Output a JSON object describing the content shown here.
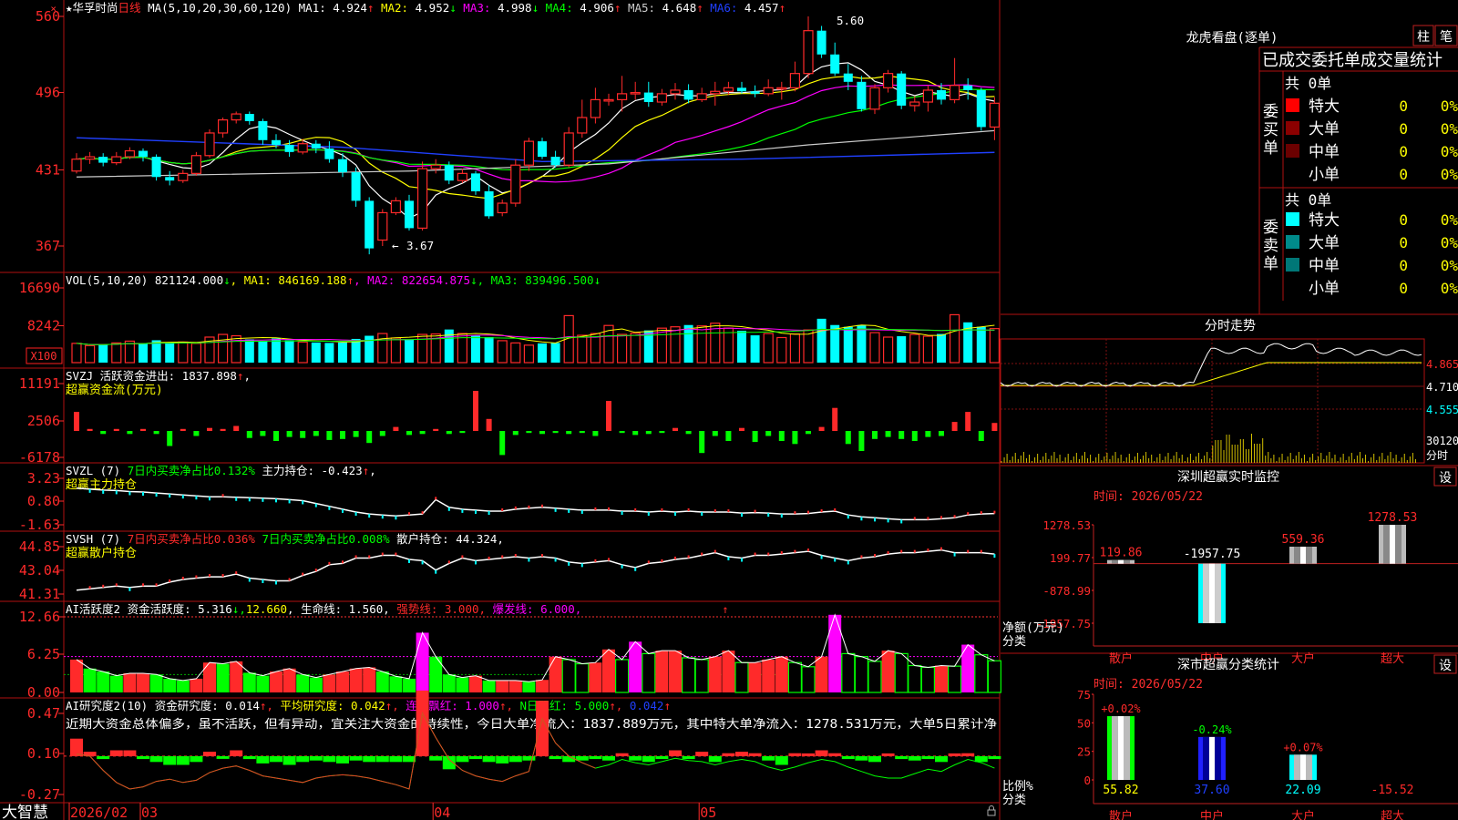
{
  "header": {
    "star": "★",
    "stock_name": "华孚时尚",
    "period": "日线",
    "ma_title": "MA(5,10,20,30,60,120)",
    "ma": [
      {
        "label": "MA1:",
        "value": "4.924",
        "arrow": "↑",
        "color": "#ffffff"
      },
      {
        "label": "MA2:",
        "value": "4.952",
        "arrow": "↓",
        "color": "#ffff00"
      },
      {
        "label": "MA3:",
        "value": "4.998",
        "arrow": "↓",
        "color": "#ff00ff"
      },
      {
        "label": "MA4:",
        "value": "4.906",
        "arrow": "↑",
        "color": "#00ff00"
      },
      {
        "label": "MA5:",
        "value": "4.648",
        "arrow": "↑",
        "color": "#cccccc"
      },
      {
        "label": "MA6:",
        "value": "4.457",
        "arrow": "↑",
        "color": "#2040ff"
      }
    ]
  },
  "kline": {
    "y_ticks": [
      "560",
      "496",
      "431",
      "367"
    ],
    "y_vals": [
      5.6,
      4.96,
      4.31,
      3.67
    ],
    "high_label": "5.60",
    "low_label": "3.67",
    "candles": [
      [
        4.3,
        4.4,
        4.28,
        4.45
      ],
      [
        4.4,
        4.42,
        4.36,
        4.46
      ],
      [
        4.42,
        4.37,
        4.34,
        4.45
      ],
      [
        4.37,
        4.42,
        4.35,
        4.46
      ],
      [
        4.42,
        4.47,
        4.4,
        4.5
      ],
      [
        4.47,
        4.42,
        4.38,
        4.49
      ],
      [
        4.42,
        4.25,
        4.22,
        4.44
      ],
      [
        4.25,
        4.22,
        4.18,
        4.3
      ],
      [
        4.22,
        4.28,
        4.2,
        4.31
      ],
      [
        4.28,
        4.43,
        4.26,
        4.46
      ],
      [
        4.43,
        4.62,
        4.41,
        4.65
      ],
      [
        4.62,
        4.73,
        4.58,
        4.75
      ],
      [
        4.73,
        4.78,
        4.7,
        4.8
      ],
      [
        4.78,
        4.72,
        4.69,
        4.8
      ],
      [
        4.72,
        4.56,
        4.52,
        4.74
      ],
      [
        4.56,
        4.52,
        4.49,
        4.61
      ],
      [
        4.52,
        4.46,
        4.42,
        4.56
      ],
      [
        4.46,
        4.53,
        4.44,
        4.57
      ],
      [
        4.53,
        4.49,
        4.45,
        4.56
      ],
      [
        4.49,
        4.4,
        4.37,
        4.55
      ],
      [
        4.4,
        4.29,
        4.25,
        4.45
      ],
      [
        4.29,
        4.05,
        4.0,
        4.33
      ],
      [
        4.05,
        3.65,
        3.6,
        4.08
      ],
      [
        3.72,
        3.95,
        3.67,
        3.98
      ],
      [
        3.95,
        4.05,
        3.93,
        4.08
      ],
      [
        4.05,
        3.82,
        3.8,
        4.1
      ],
      [
        3.82,
        4.32,
        3.8,
        4.38
      ],
      [
        4.32,
        4.35,
        4.28,
        4.4
      ],
      [
        4.35,
        4.22,
        4.19,
        4.38
      ],
      [
        4.22,
        4.28,
        4.2,
        4.32
      ],
      [
        4.28,
        4.13,
        4.1,
        4.3
      ],
      [
        4.13,
        3.92,
        3.9,
        4.18
      ],
      [
        3.95,
        4.03,
        3.92,
        4.06
      ],
      [
        4.03,
        4.35,
        4.0,
        4.4
      ],
      [
        4.35,
        4.55,
        4.3,
        4.58
      ],
      [
        4.55,
        4.42,
        4.4,
        4.58
      ],
      [
        4.42,
        4.35,
        4.33,
        4.47
      ],
      [
        4.35,
        4.62,
        4.33,
        4.67
      ],
      [
        4.62,
        4.75,
        4.58,
        4.9
      ],
      [
        4.75,
        4.9,
        4.7,
        5.0
      ],
      [
        4.9,
        4.9,
        4.85,
        4.95
      ],
      [
        4.9,
        4.95,
        4.8,
        5.1
      ],
      [
        4.95,
        4.96,
        4.9,
        5.05
      ],
      [
        4.96,
        4.88,
        4.84,
        5.05
      ],
      [
        4.88,
        4.95,
        4.85,
        4.99
      ],
      [
        4.95,
        4.98,
        4.9,
        5.04
      ],
      [
        4.98,
        4.9,
        4.87,
        5.03
      ],
      [
        4.9,
        4.95,
        4.88,
        5.0
      ],
      [
        4.95,
        4.97,
        4.85,
        5.05
      ],
      [
        4.97,
        5.0,
        4.94,
        5.05
      ],
      [
        5.0,
        4.97,
        4.95,
        5.05
      ],
      [
        4.97,
        4.95,
        4.92,
        5.02
      ],
      [
        4.95,
        5.0,
        4.93,
        5.07
      ],
      [
        5.0,
        5.0,
        4.9,
        5.05
      ],
      [
        5.0,
        5.12,
        4.97,
        5.22
      ],
      [
        5.12,
        5.48,
        5.08,
        5.6
      ],
      [
        5.48,
        5.28,
        5.25,
        5.52
      ],
      [
        5.28,
        5.12,
        5.1,
        5.38
      ],
      [
        5.12,
        5.05,
        4.98,
        5.2
      ],
      [
        5.05,
        4.82,
        4.8,
        5.1
      ],
      [
        4.82,
        5.0,
        4.78,
        5.03
      ],
      [
        5.0,
        5.12,
        4.96,
        5.15
      ],
      [
        5.12,
        4.85,
        4.82,
        5.14
      ],
      [
        4.85,
        4.88,
        4.8,
        4.93
      ],
      [
        4.88,
        4.98,
        4.8,
        5.02
      ],
      [
        4.98,
        4.9,
        4.86,
        5.04
      ],
      [
        4.9,
        5.02,
        4.87,
        5.25
      ],
      [
        5.02,
        4.98,
        4.9,
        5.08
      ],
      [
        4.98,
        4.67,
        4.64,
        5.0
      ],
      [
        4.67,
        4.87,
        4.56,
        4.92
      ]
    ]
  },
  "vol": {
    "title": "VOL(5,10,20)",
    "value": "821124.000",
    "value_arrow": "↓",
    "mas": [
      {
        "label": "MA1:",
        "value": "846169.188",
        "arrow": "↑",
        "color": "#ffff00"
      },
      {
        "label": "MA2:",
        "value": "822654.875",
        "arrow": "↓",
        "color": "#ff00ff"
      },
      {
        "label": "MA3:",
        "value": "839496.500",
        "arrow": "↓",
        "color": "#00ff00"
      }
    ],
    "y_ticks": [
      "16690",
      "8242"
    ],
    "unit": "X100",
    "values": [
      4.3,
      3.8,
      4.0,
      4.4,
      4.8,
      4.2,
      5.0,
      4.4,
      4.6,
      4.3,
      5.7,
      6.3,
      6.0,
      5.2,
      4.8,
      5.4,
      5.0,
      4.6,
      4.5,
      4.4,
      4.5,
      5.3,
      6.0,
      6.5,
      5.5,
      5.1,
      6.3,
      6.4,
      7.4,
      6.5,
      6.0,
      5.7,
      4.9,
      4.4,
      3.9,
      4.3,
      4.4,
      10.5,
      6.1,
      6.5,
      8.3,
      6.3,
      6.6,
      7.2,
      7.7,
      8.0,
      8.4,
      8.2,
      8.8,
      7.7,
      7.1,
      6.1,
      6.5,
      5.6,
      6.4,
      7.3,
      9.8,
      8.4,
      8.0,
      8.4,
      6.7,
      5.7,
      5.9,
      6.3,
      5.9,
      6.4,
      10.7,
      9.0,
      8.0,
      7.6
    ]
  },
  "svzj": {
    "title": "SVZJ",
    "label": "活跃资金进出:",
    "value": "1837.898",
    "arrow": "↑",
    "subtitle": "超赢资金流(万元)",
    "y_ticks": [
      "11191",
      "2506",
      "-6178"
    ],
    "values": [
      1.9,
      0.2,
      -0.3,
      0.2,
      -0.3,
      0.2,
      -0.3,
      -1.5,
      0.2,
      -0.5,
      0.3,
      0.2,
      0.5,
      -0.7,
      -0.5,
      -1.0,
      -0.6,
      -0.7,
      -0.5,
      -0.9,
      -0.8,
      -0.6,
      -1.2,
      -0.5,
      0.4,
      -0.4,
      -0.3,
      0.2,
      -0.3,
      -0.2,
      4.0,
      1.2,
      -2.4,
      -0.4,
      -0.2,
      -0.3,
      -0.2,
      -0.3,
      -0.2,
      -0.5,
      3.0,
      -0.2,
      -0.4,
      -0.3,
      -0.2,
      0.3,
      -0.3,
      -2.2,
      -0.5,
      -1.0,
      0.3,
      -1.1,
      -0.5,
      -1.0,
      -1.3,
      -0.3,
      0.4,
      2.3,
      -1.3,
      -2.0,
      -0.8,
      -0.6,
      -0.8,
      -1.0,
      -0.6,
      -0.5,
      0.9,
      1.9,
      -1.0,
      0.8
    ]
  },
  "svzl": {
    "title": "SVZL (7)",
    "p1": "7日内买卖净占比0.132%",
    "label": "主力持仓:",
    "value": "-0.423",
    "arrow": "↑",
    "tail": ",",
    "subtitle": "超赢主力持仓",
    "y_ticks": [
      "3.23",
      "0.80",
      "-1.63"
    ],
    "values": [
      2.2,
      2.1,
      2.0,
      1.95,
      1.85,
      1.8,
      1.7,
      1.6,
      1.5,
      1.4,
      1.3,
      1.3,
      1.25,
      1.2,
      1.15,
      1.1,
      1.0,
      0.9,
      0.6,
      0.3,
      0.0,
      -0.3,
      -0.5,
      -0.6,
      -0.7,
      -0.6,
      -0.5,
      1.0,
      0.2,
      0.0,
      -0.1,
      -0.2,
      -0.2,
      0.0,
      0.1,
      0.2,
      0.1,
      0.0,
      -0.1,
      -0.1,
      -0.1,
      -0.2,
      -0.2,
      -0.3,
      -0.2,
      -0.3,
      -0.2,
      -0.3,
      -0.3,
      -0.3,
      -0.4,
      -0.35,
      -0.4,
      -0.5,
      -0.5,
      -0.45,
      -0.3,
      -0.2,
      -0.6,
      -0.8,
      -0.9,
      -1.0,
      -1.1,
      -1.1,
      -1.1,
      -1.0,
      -0.9,
      -0.6,
      -0.5,
      -0.45
    ]
  },
  "svsh": {
    "title": "SVSH (7)",
    "p1": "7日内买卖净占比0.036%",
    "p2": "7日内买卖净占比0.008%",
    "label": "散户持仓:",
    "value": "44.324",
    "arrow": "↑",
    "tail": ",",
    "subtitle": "超赢散户持仓",
    "y_ticks": [
      "44.85",
      "43.04",
      "41.31"
    ],
    "values": [
      41.6,
      41.7,
      41.8,
      41.9,
      41.8,
      41.9,
      41.9,
      42.2,
      42.4,
      42.5,
      42.6,
      42.6,
      42.8,
      42.5,
      42.4,
      42.3,
      42.3,
      42.7,
      43.0,
      43.5,
      43.6,
      44.0,
      44.0,
      44.2,
      44.2,
      43.9,
      43.8,
      43.1,
      43.6,
      44.0,
      43.8,
      43.9,
      44.0,
      44.1,
      44.0,
      44.1,
      44.0,
      43.7,
      43.6,
      43.7,
      43.8,
      43.5,
      43.3,
      43.6,
      43.7,
      43.9,
      44.0,
      44.2,
      44.4,
      44.1,
      44.0,
      44.2,
      44.2,
      44.3,
      44.4,
      44.5,
      44.2,
      44.0,
      43.8,
      44.0,
      44.1,
      44.3,
      44.4,
      44.4,
      44.5,
      44.6,
      44.4,
      44.4,
      44.4,
      44.3
    ]
  },
  "ai_active": {
    "title": "AI活跃度2",
    "label": "资金活跃度:",
    "value": "5.316",
    "arrow": "↓",
    "v2": "12.660",
    "l3": "生命线:",
    "v3": "1.560",
    "l4": "强势线:",
    "v4": "3.000",
    "l5": "爆发线:",
    "v5": "6.000",
    "y_ticks": [
      "12.66",
      "6.25",
      "0.00"
    ],
    "values": [
      5.5,
      4.0,
      3.5,
      2.8,
      3.2,
      3.2,
      3.0,
      2.3,
      2.0,
      2.3,
      5.0,
      4.8,
      5.2,
      3.3,
      2.8,
      3.5,
      4.0,
      3.0,
      2.5,
      3.0,
      3.5,
      4.0,
      4.2,
      3.5,
      2.7,
      2.3,
      10.0,
      6.0,
      3.0,
      2.5,
      2.8,
      2.0,
      2.0,
      2.0,
      1.8,
      2.1,
      6.0,
      5.5,
      4.8,
      5.0,
      7.2,
      5.5,
      8.5,
      6.5,
      7.0,
      7.0,
      5.8,
      5.5,
      6.0,
      7.0,
      5.0,
      5.0,
      5.5,
      6.0,
      5.0,
      4.3,
      6.0,
      13.0,
      6.5,
      6.0,
      5.2,
      7.0,
      6.5,
      4.5,
      4.2,
      4.5,
      4.4,
      8.0,
      6.3,
      5.3
    ]
  },
  "ai_research": {
    "title": "AI研究度2(10)",
    "label": "资金研究度:",
    "value": "0.014",
    "arrow": "↑",
    "l2": "平均研究度:",
    "v2": "0.042",
    "l3": "连续飘红:",
    "v3": "1.000",
    "l4": "N日飘红:",
    "v4": "5.000",
    "v5": "0.042",
    "text": "近期大资金总体偏多，虽不活跃，但有异动，宜关注大资金的持续性，今日大单净流入：1837.889万元，其中特大单净流入：1278.531万元，大单5日累计净",
    "y_ticks": [
      "0.47",
      "0.10",
      "-0.27"
    ],
    "values": [
      0.12,
      0.03,
      -0.02,
      0.04,
      0.04,
      -0.02,
      -0.04,
      -0.06,
      -0.06,
      -0.04,
      0.03,
      -0.01,
      0.04,
      -0.02,
      -0.05,
      -0.04,
      -0.06,
      -0.04,
      -0.03,
      -0.04,
      -0.05,
      -0.03,
      -0.04,
      -0.04,
      -0.04,
      -0.04,
      0.45,
      -0.03,
      -0.09,
      -0.04,
      -0.02,
      -0.04,
      -0.05,
      -0.04,
      -0.03,
      0.38,
      -0.02,
      -0.04,
      -0.03,
      -0.02,
      -0.03,
      0.02,
      -0.03,
      -0.04,
      -0.02,
      0.04,
      -0.02,
      0.03,
      -0.04,
      0.02,
      0.03,
      0.02,
      -0.03,
      -0.06,
      0.02,
      0.01,
      0.04,
      0.02,
      -0.02,
      -0.03,
      -0.04,
      0.01,
      -0.02,
      -0.03,
      -0.02,
      -0.04,
      0.01,
      0.02,
      -0.04,
      -0.02
    ],
    "curve": [
      0.1,
      0.08,
      -0.05,
      -0.16,
      -0.22,
      -0.2,
      -0.15,
      -0.13,
      -0.16,
      -0.14,
      -0.07,
      -0.03,
      -0.01,
      -0.05,
      -0.1,
      -0.12,
      -0.14,
      -0.16,
      -0.12,
      -0.1,
      -0.09,
      -0.1,
      -0.12,
      -0.15,
      -0.18,
      -0.22,
      0.47,
      0.25,
      0.05,
      -0.05,
      -0.1,
      -0.13,
      -0.15,
      -0.1,
      -0.06,
      0.42,
      0.2,
      0.08,
      0.02,
      -0.03,
      0.0,
      0.05,
      0.02,
      0.0,
      0.03,
      0.06,
      0.04,
      0.03,
      0.0,
      0.03,
      0.05,
      0.03,
      -0.02,
      -0.05,
      -0.02,
      0.02,
      0.05,
      0.03,
      -0.02,
      -0.06,
      -0.1,
      -0.12,
      -0.12,
      -0.08,
      -0.04,
      -0.06,
      0.0,
      0.05,
      0.02,
      -0.03
    ]
  },
  "xaxis": {
    "logo": "大智慧",
    "labels": [
      {
        "i": 0,
        "t": "2026/02"
      },
      {
        "i": 5,
        "t": "03"
      },
      {
        "i": 27,
        "t": "04"
      },
      {
        "i": 47,
        "t": "05"
      }
    ]
  },
  "right": {
    "tiger_title": "龙虎看盘(逐单)",
    "tab_pillar": "柱",
    "tab_stroke": "笔",
    "stats_header": "已成交委托单成交量统计",
    "buy_label": "委买单",
    "sell_label": "委卖单",
    "buy_total": "共 0单",
    "sell_total": "共 0单",
    "buy_rows": [
      {
        "name": "特大",
        "count": "0",
        "pct": "0%",
        "color": "#ff0000"
      },
      {
        "name": "大单",
        "count": "0",
        "pct": "0%",
        "color": "#8b0000"
      },
      {
        "name": "中单",
        "count": "0",
        "pct": "0%",
        "color": "#6b0000"
      },
      {
        "name": "小单",
        "count": "0",
        "pct": "0%",
        "color": ""
      }
    ],
    "sell_rows": [
      {
        "name": "特大",
        "count": "0",
        "pct": "0%",
        "color": "#00ffff"
      },
      {
        "name": "大单",
        "count": "0",
        "pct": "0%",
        "color": "#008b8b"
      },
      {
        "name": "中单",
        "count": "0",
        "pct": "0%",
        "color": "#007777"
      },
      {
        "name": "小单",
        "count": "0",
        "pct": "0%",
        "color": ""
      }
    ],
    "intraday_title": "分时走势",
    "intraday_ticks": [
      "4.865",
      "4.710",
      "4.555",
      "30120"
    ],
    "intraday_unit": "分时",
    "sz_title": "深圳超赢实时监控",
    "sz_set": "设",
    "sz_time": "时间: 2026/05/22",
    "sz_ticks": [
      "1278.53",
      "199.77",
      "-878.99",
      "-1957.75"
    ],
    "sz_axis_label": "净额(万元)",
    "sz_axis_label2": "分类",
    "sz_chart": {
      "type": "bar",
      "categories": [
        "散户",
        "中户",
        "大户",
        "超大"
      ],
      "values": [
        119.86,
        -1957.75,
        559.36,
        1278.53
      ],
      "labels": [
        "119.86",
        "-1957.75",
        "559.36",
        "1278.53"
      ],
      "ylim": [
        -1957.75,
        1278.53
      ]
    },
    "ss_title": "深市超赢分类统计",
    "ss_set": "设",
    "ss_time": "时间: 2026/05/22",
    "ss_ticks": [
      "75",
      "50",
      "25",
      "0"
    ],
    "ss_axis_label": "比例%",
    "ss_axis_label2": "分类",
    "ss_chart": {
      "type": "bar",
      "categories": [
        "散户",
        "中户",
        "大户",
        "超大"
      ],
      "values": [
        55.82,
        37.6,
        22.09,
        -15.52
      ],
      "labels": [
        "55.82",
        "37.60",
        "22.09",
        "-15.52"
      ],
      "changes": [
        "+0.02%",
        "-0.24%",
        "+0.07%",
        ""
      ],
      "ylim": [
        0,
        75
      ]
    }
  }
}
